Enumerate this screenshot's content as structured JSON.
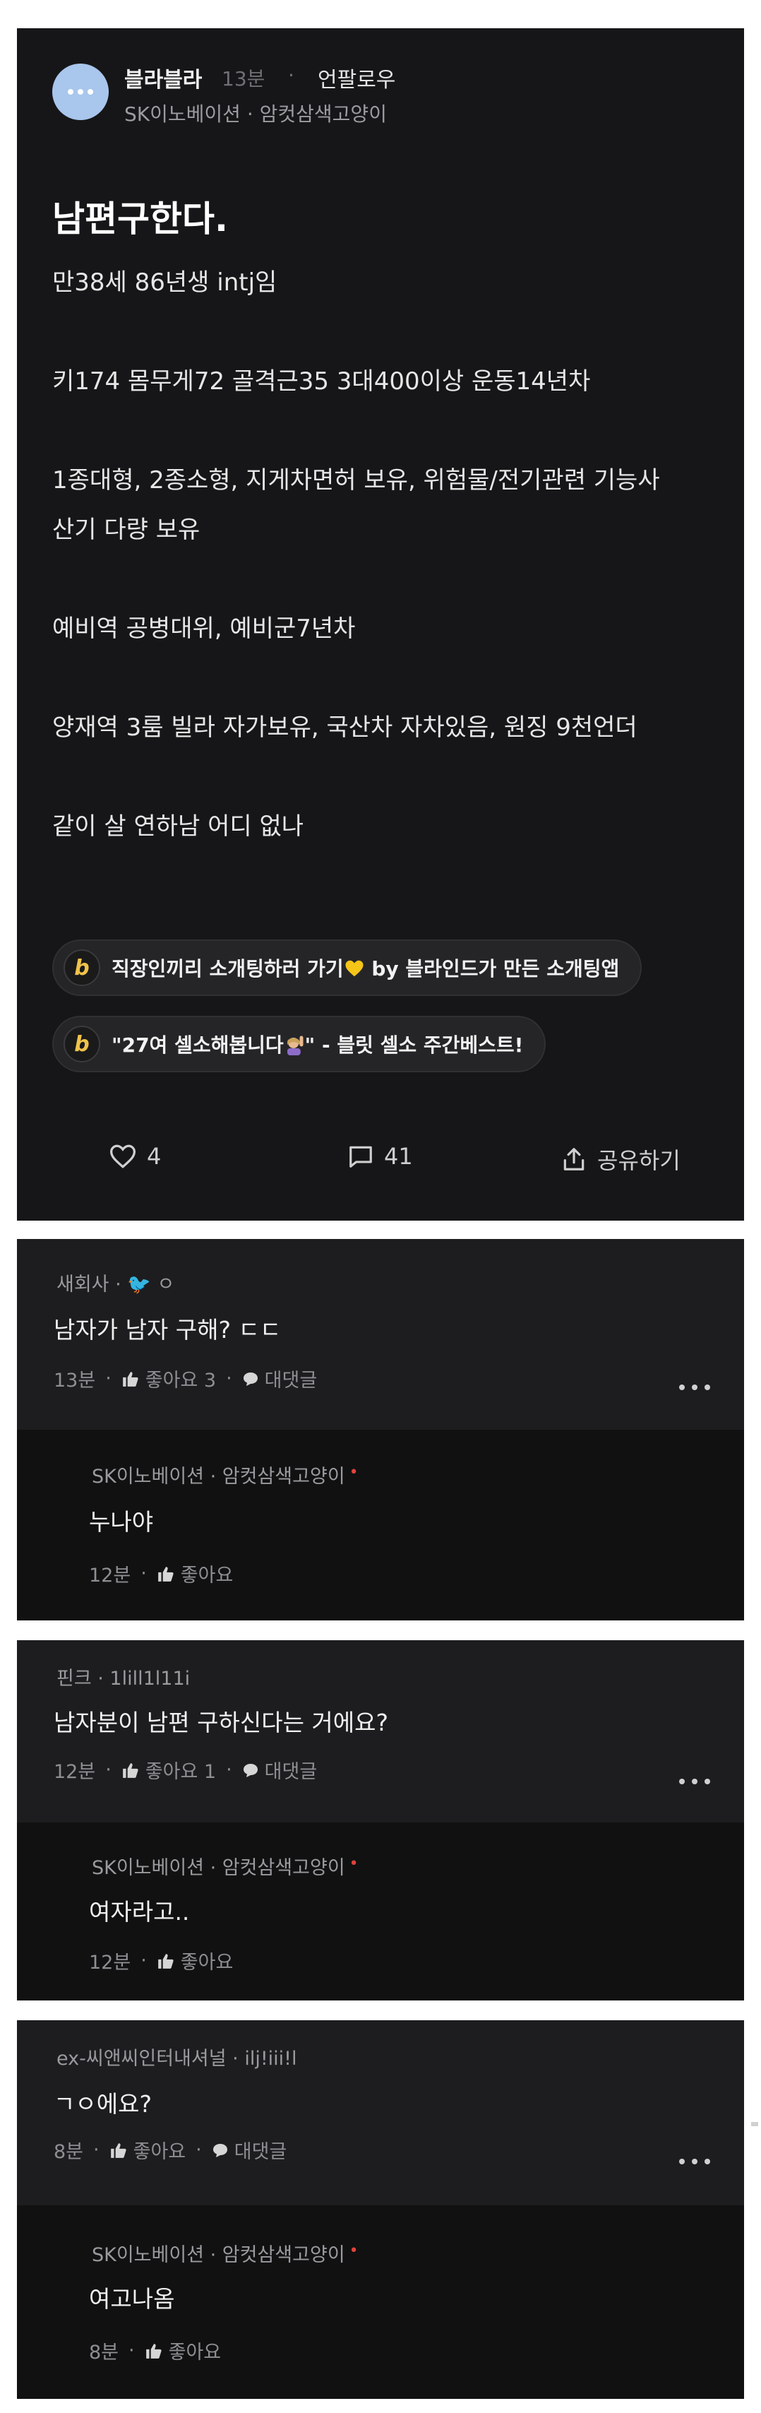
{
  "post": {
    "author": "블라블라",
    "time": "13분",
    "follow_label": "언팔로우",
    "company": "SK이노베이션 · 암컷삼색고양이",
    "title": "남편구한다.",
    "body_lines": [
      "만38세 86년생 intj임",
      "",
      "키174 몸무게72 골격근35 3대400이상 운동14년차",
      "",
      "1종대형, 2종소형, 지게차면허 보유, 위험물/전기관련 기능사",
      "산기 다량 보유",
      "",
      "예비역 공병대위, 예비군7년차",
      "",
      "양재역 3룸 빌라 자가보유, 국산차 자차있음, 원징 9천언더",
      "",
      "같이 살 연하남 어디 없나"
    ],
    "promo_1": "직장인끼리 소개팅하러 가기",
    "promo_1_suffix": " by 블라인드가 만든 소개팅앱",
    "promo_2": "\"27여 셀소해봅니다",
    "promo_2_suffix": "\" - 블릿 셀소 주간베스트!",
    "promo_badge": "b",
    "likes": "4",
    "comments": "41",
    "share_label": "공유하기"
  },
  "threads": [
    {
      "comment": {
        "author": "새회사 · 🐦 ㅇ",
        "text": "남자가 남자 구해? ㄷㄷ",
        "time": "13분",
        "like_label": "좋아요 3",
        "reply_label": "대댓글"
      },
      "reply": {
        "author": "SK이노베이션 · 암컷삼색고양이",
        "text": "누나야",
        "time": "12분",
        "like_label": "좋아요"
      }
    },
    {
      "comment": {
        "author": "핀크 · 1lill1l11i",
        "text": "남자분이 남편 구하신다는 거에요?",
        "time": "12분",
        "like_label": "좋아요 1",
        "reply_label": "대댓글"
      },
      "reply": {
        "author": "SK이노베이션 · 암컷삼색고양이",
        "text": "여자라고..",
        "time": "12분",
        "like_label": "좋아요"
      }
    },
    {
      "comment": {
        "author": "ex-씨앤씨인터내셔널 · ilj!iii!l",
        "text": "ㄱㅇ에요?",
        "time": "8분",
        "like_label": "좋아요",
        "reply_label": "대댓글"
      },
      "reply": {
        "author": "SK이노베이션 · 암컷삼색고양이",
        "text": "여고나옴",
        "time": "8분",
        "like_label": "좋아요"
      }
    }
  ],
  "colors": {
    "background": "#ffffff",
    "card": "#161618",
    "comment_bg": "#1d1d1f",
    "reply_bg": "#111112",
    "badge_yellow": "#f0c24a",
    "author_dot_red": "#e0433b"
  }
}
